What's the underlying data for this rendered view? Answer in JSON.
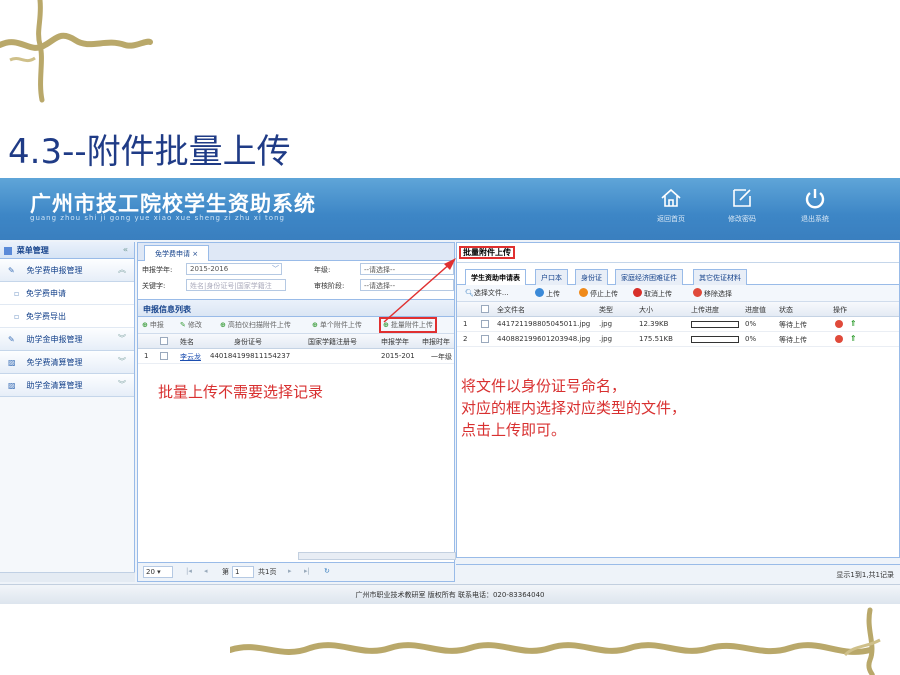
{
  "slide": {
    "title": "4.3--附件批量上传",
    "colors": {
      "title": "#1f3b86",
      "annotation": "#d83030",
      "highlight_box": "#e03030",
      "banner": "#3d86c6"
    }
  },
  "app": {
    "system_title": "广州市技工院校学生资助系统",
    "system_subtitle": "guang zhou shi ji gong yue xiao xue sheng zi zhu xi tong",
    "header_buttons": [
      {
        "label": "返回首页",
        "icon": "home-icon"
      },
      {
        "label": "修改密码",
        "icon": "edit-icon"
      },
      {
        "label": "退出系统",
        "icon": "power-icon"
      }
    ]
  },
  "menu": {
    "title": "菜单管理",
    "groups": [
      {
        "label": "免学费申报管理",
        "icon": "pencil-icon",
        "expanded": true,
        "items": [
          "免学费申请",
          "免学费导出"
        ]
      },
      {
        "label": "助学金申报管理",
        "icon": "pencil-icon",
        "expanded": false
      },
      {
        "label": "免学费清算管理",
        "icon": "chart-icon",
        "expanded": false
      },
      {
        "label": "助学金清算管理",
        "icon": "chart-icon",
        "expanded": false
      }
    ]
  },
  "center": {
    "tab": "免学费申请 ×",
    "form": {
      "year_label": "申报学年:",
      "year_value": "2015-2016",
      "grade_label": "年级:",
      "grade_value": "--请选择--",
      "keyword_label": "关键字:",
      "keyword_placeholder": "姓名|身份证号|国家学籍注",
      "stage_label": "审核阶段:",
      "stage_value": "--请选择--"
    },
    "section_title": "申报信息列表",
    "toolbar": [
      "申报",
      "修改",
      "高拍仪扫描附件上传",
      "单个附件上传",
      "批量附件上传"
    ],
    "columns": [
      "姓名",
      "身份证号",
      "国家学籍注册号",
      "申报学年",
      "申报时年"
    ],
    "rows": [
      {
        "no": "1",
        "name": "李云龙",
        "id": "440184199811154237",
        "reg": "",
        "year": "2015-201",
        "grade": "一年级"
      }
    ],
    "pager": {
      "size": "20",
      "page_label": "第",
      "page": "1",
      "total": "共1页"
    }
  },
  "upload": {
    "title": "批量附件上传",
    "tabs": [
      "学生资助申请表",
      "户口本",
      "身份证",
      "家庭经济困难证件",
      "其它佐证材料"
    ],
    "actions": [
      {
        "label": "选择文件...",
        "icon": "search-icon"
      },
      {
        "label": "上传",
        "icon": "upload-icon"
      },
      {
        "label": "停止上传",
        "icon": "stop-icon"
      },
      {
        "label": "取消上传",
        "icon": "cancel-icon"
      },
      {
        "label": "移除选择",
        "icon": "remove-icon"
      }
    ],
    "columns": [
      "全文件名",
      "类型",
      "大小",
      "上传进度",
      "进度值",
      "状态",
      "操作"
    ],
    "files": [
      {
        "no": "1",
        "name": "441721198805045011.jpg",
        "type": ".jpg",
        "size": "12.39KB",
        "progress": 0,
        "progress_label": "0%",
        "status": "等待上传"
      },
      {
        "no": "2",
        "name": "440882199601203948.jpg",
        "type": ".jpg",
        "size": "175.51KB",
        "progress": 0,
        "progress_label": "0%",
        "status": "等待上传"
      }
    ],
    "annotation": [
      "将文件以身份证号命名，",
      "对应的框内选择对应类型的文件，",
      "点击上传即可。"
    ],
    "footer": "显示1到1,共1记录"
  },
  "center_annotation": "批量上传不需要选择记录",
  "footer": "广州市职业技术教研室   版权所有   联系电话：020-83364040"
}
